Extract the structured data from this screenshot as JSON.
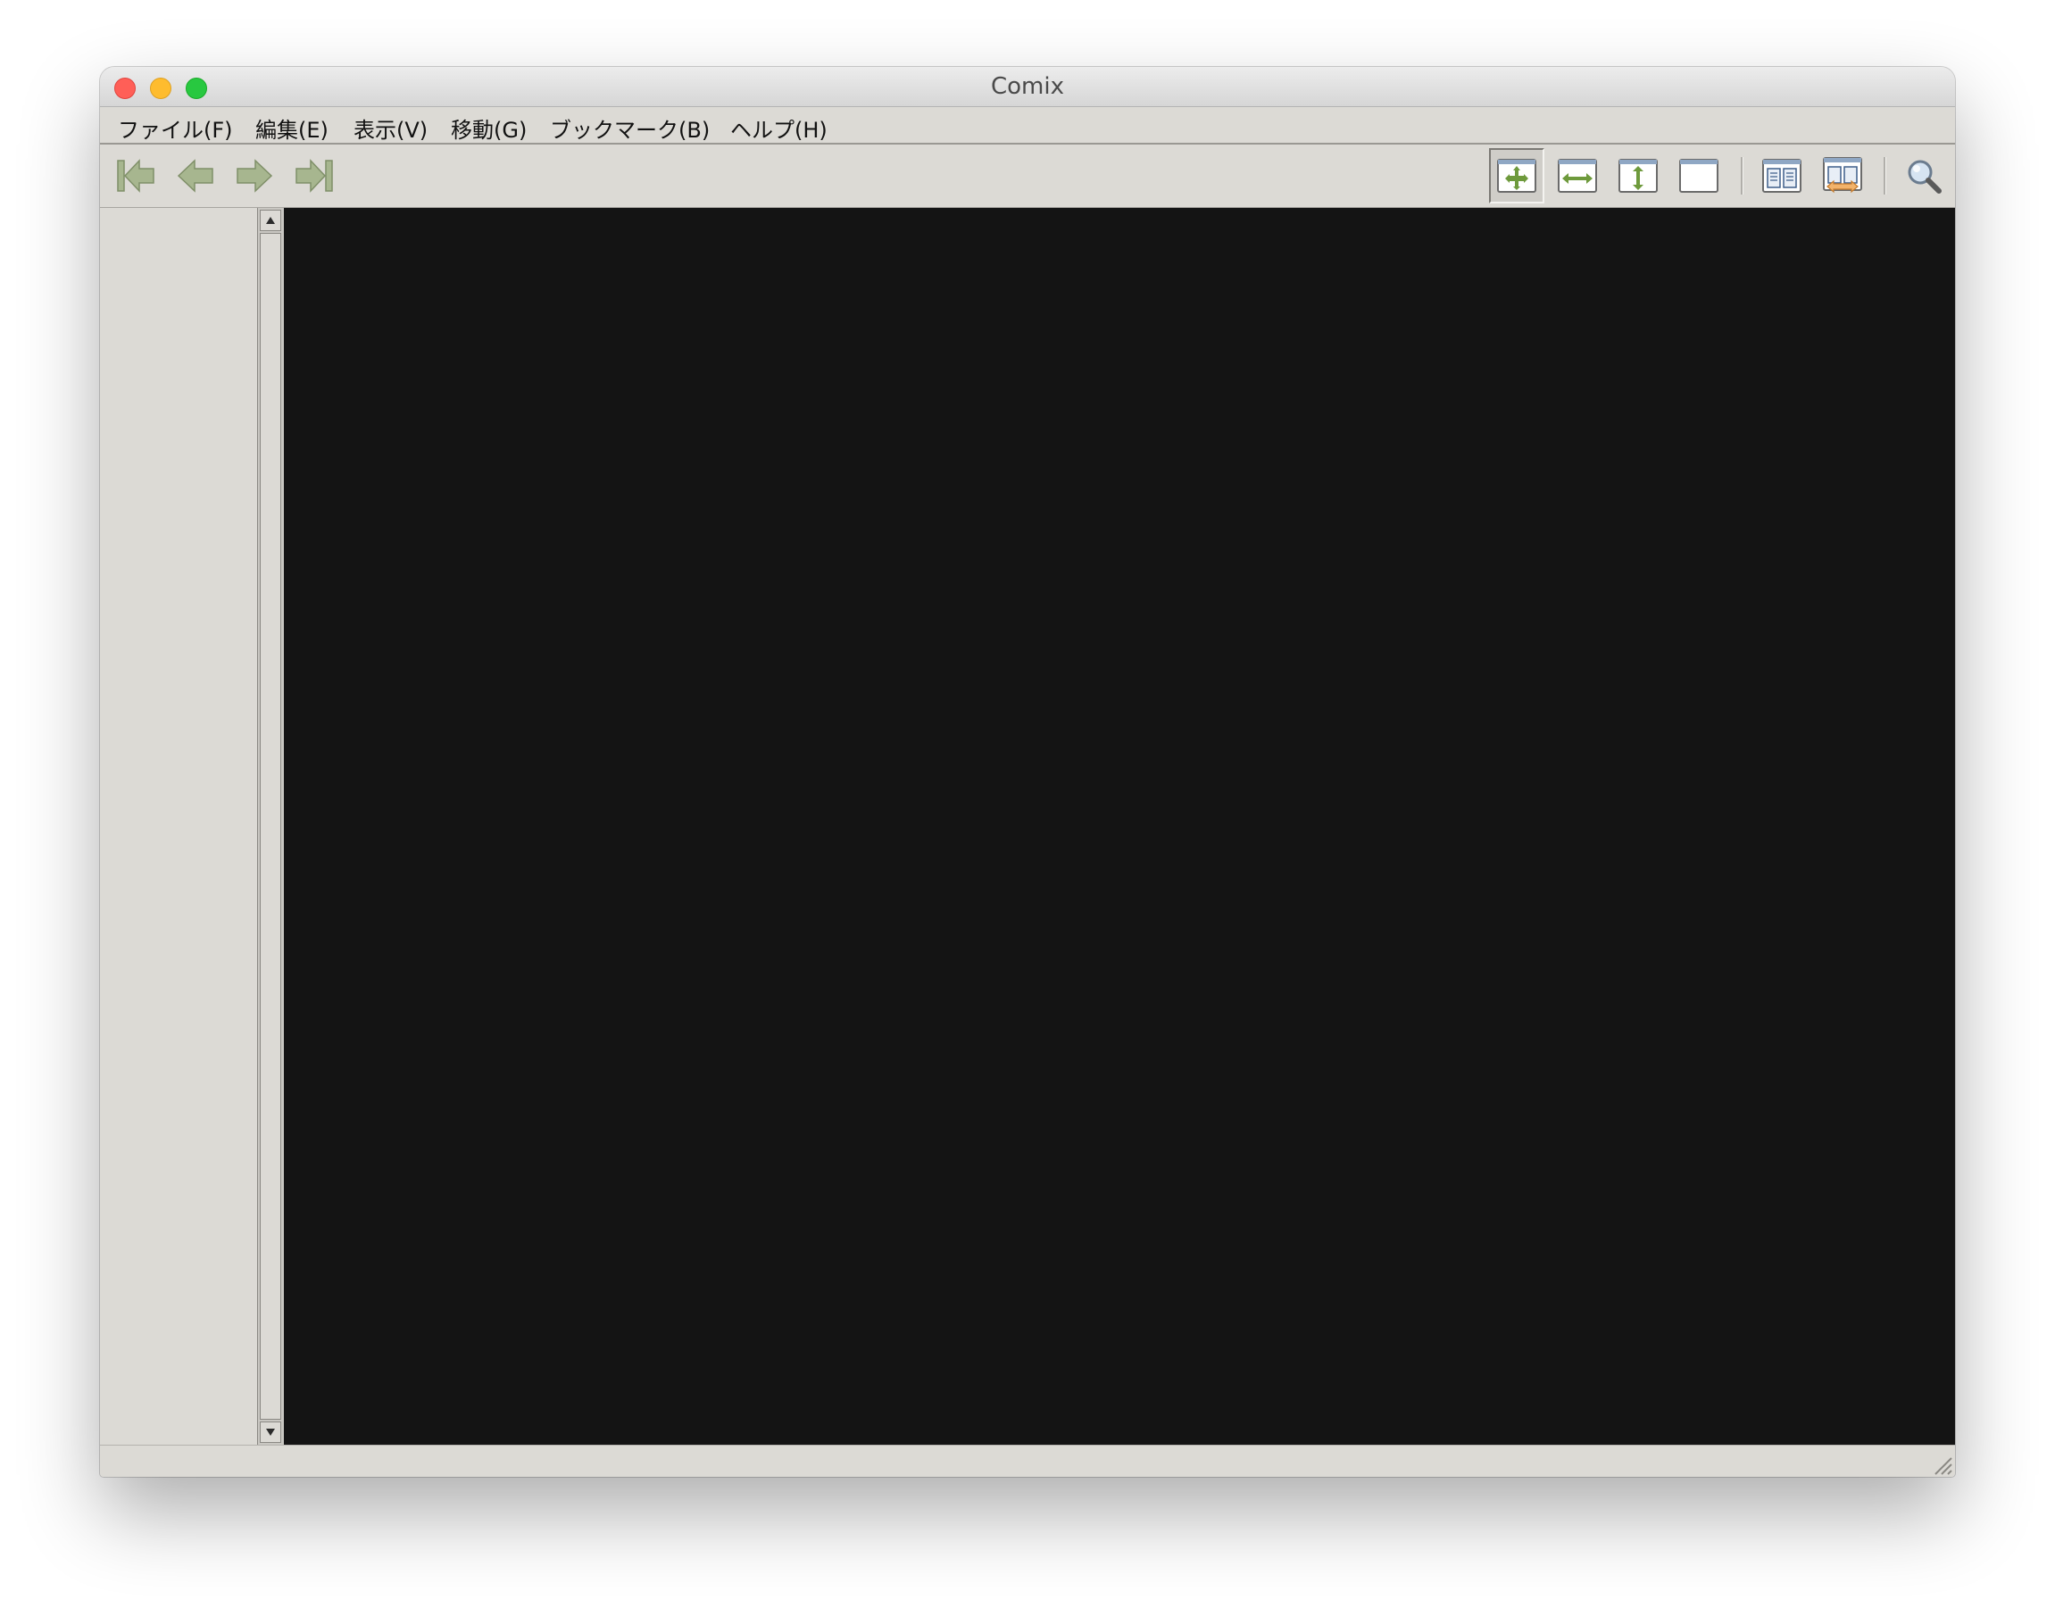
{
  "window": {
    "title": "Comix"
  },
  "menubar": {
    "items": [
      {
        "label": "ファイル(F)"
      },
      {
        "label": "編集(E)"
      },
      {
        "label": "表示(V)"
      },
      {
        "label": "移動(G)"
      },
      {
        "label": "ブックマーク(B)"
      },
      {
        "label": "ヘルプ(H)"
      }
    ]
  },
  "toolbar": {
    "nav_icons": [
      "first-page-icon",
      "previous-page-icon",
      "next-page-icon",
      "last-page-icon"
    ],
    "view_icons": [
      "best-fit-icon",
      "fit-width-icon",
      "fit-height-icon",
      "manual-zoom-icon",
      "double-page-icon",
      "manga-mode-icon",
      "zoom-icon"
    ],
    "active": "best-fit",
    "accent_green": "#6e9a3c",
    "disabled_green": "#a7b68f"
  }
}
